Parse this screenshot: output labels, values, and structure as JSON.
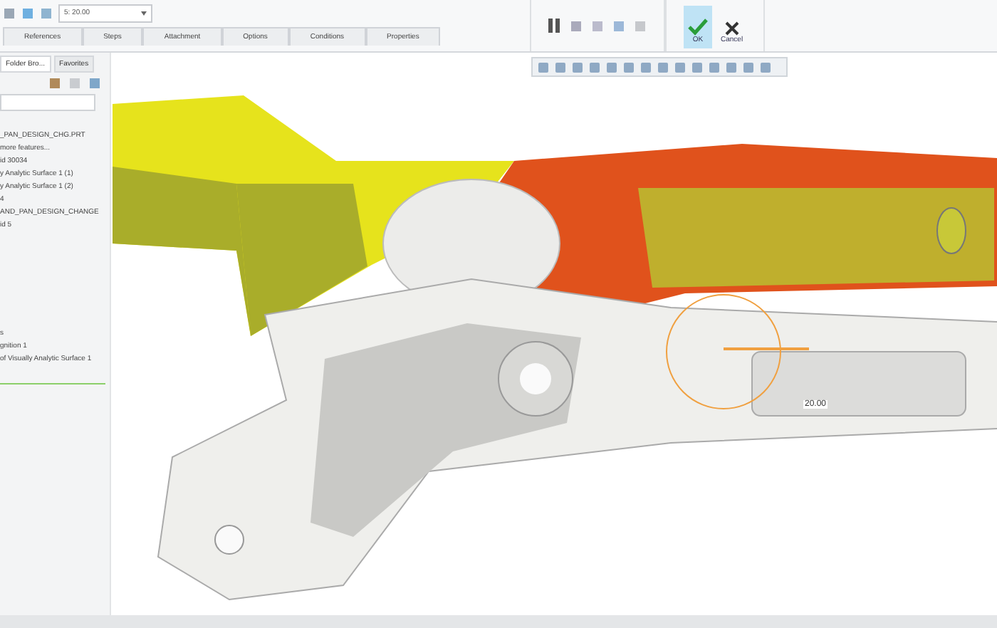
{
  "toolbar": {
    "field_value": "5: 20.00"
  },
  "tabs": [
    {
      "label": "References",
      "selected": false
    },
    {
      "label": "Steps",
      "selected": false
    },
    {
      "label": "Attachment",
      "selected": false
    },
    {
      "label": "Options",
      "selected": false
    },
    {
      "label": "Conditions",
      "selected": false
    },
    {
      "label": "Properties",
      "selected": false
    }
  ],
  "actions": {
    "ok": "OK",
    "cancel": "Cancel"
  },
  "sidebar": {
    "tabs": [
      {
        "label": "Folder Bro...",
        "selected": true
      },
      {
        "label": "Favorites",
        "selected": false
      }
    ],
    "tree": [
      "_PAN_DESIGN_CHG.PRT",
      "more features...",
      "id 30034",
      "y Analytic Surface 1 (1)",
      "y Analytic Surface 1 (2)",
      "4",
      "AND_PAN_DESIGN_CHANGE",
      "id 5"
    ],
    "tree_lower": [
      "s",
      "gnition 1",
      "of Visually Analytic Surface 1"
    ]
  },
  "viewport": {
    "dimension": "20.00"
  }
}
